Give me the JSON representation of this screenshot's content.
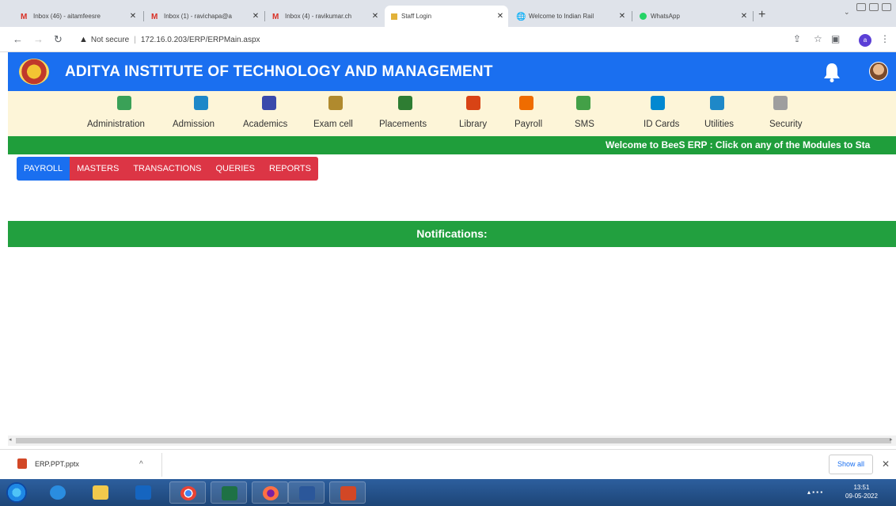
{
  "browser": {
    "tabs": [
      {
        "title": "Inbox (46) - aitamfeesre",
        "icon": "gmail-icon"
      },
      {
        "title": "Inbox (1) - ravichapa@a",
        "icon": "gmail-icon"
      },
      {
        "title": "Inbox (4) - ravikumar.ch",
        "icon": "gmail-icon"
      },
      {
        "title": "Staff Login",
        "icon": "site-icon"
      },
      {
        "title": "Welcome to Indian Rail",
        "icon": "globe-icon"
      },
      {
        "title": "WhatsApp",
        "icon": "whatsapp-icon"
      }
    ],
    "active_tab": 3,
    "security_label": "Not secure",
    "url": "172.16.0.203/ERP/ERPMain.aspx",
    "profile_initial": "a"
  },
  "app": {
    "title": "ADITYA INSTITUTE OF TECHNOLOGY AND MANAGEMENT",
    "brand_color": "#1a6ff0"
  },
  "modules": [
    {
      "label": "Administration",
      "icon": "admin-user-icon",
      "color": "#3aa157"
    },
    {
      "label": "Admission",
      "icon": "building-icon",
      "color": "#1e88c8"
    },
    {
      "label": "Academics",
      "icon": "graduate-icon",
      "color": "#3949ab"
    },
    {
      "label": "Exam cell",
      "icon": "clipboard-icon",
      "color": "#b08a2e"
    },
    {
      "label": "Placements",
      "icon": "person-desk-icon",
      "color": "#2e7d32"
    },
    {
      "label": "Library",
      "icon": "books-icon",
      "color": "#d84315"
    },
    {
      "label": "Payroll",
      "icon": "people-icon",
      "color": "#ef6c00"
    },
    {
      "label": "SMS",
      "icon": "phone-message-icon",
      "color": "#43a047"
    },
    {
      "label": "ID Cards",
      "icon": "id-card-icon",
      "color": "#0288d1"
    },
    {
      "label": "Utilities",
      "icon": "tools-icon",
      "color": "#1e88c8"
    },
    {
      "label": "Security",
      "icon": "database-icon",
      "color": "#9e9e9e"
    }
  ],
  "marquee": "Welcome to BeeS ERP : Click on any of the Modules to Sta",
  "submenu": [
    "PAYROLL",
    "MASTERS",
    "TRANSACTIONS",
    "QUERIES",
    "REPORTS"
  ],
  "notifications_label": "Notifications:",
  "downloads": {
    "file_name": "ERP.PPT.pptx",
    "show_all_label": "Show all"
  },
  "taskbar": {
    "time": "13:51",
    "date": "09-05-2022"
  }
}
